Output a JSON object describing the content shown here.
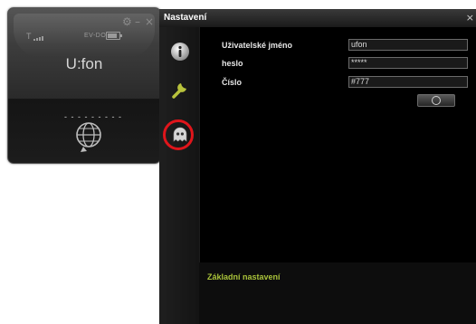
{
  "widget": {
    "name": "U:fon",
    "network": "EV-DO",
    "signal_label": "T",
    "battery_level": 0.8,
    "number_display": "- - - - - - - - -",
    "controls": {
      "settings_glyph": "⚙",
      "minimize_glyph": "–",
      "close_glyph": "×"
    },
    "icons": {
      "signal": "signal-icon",
      "battery": "battery-icon",
      "dial": "globe-call-icon"
    }
  },
  "settings_window": {
    "title": "Nastavení",
    "close_glyph": "×",
    "sidebar": [
      {
        "name": "info-icon",
        "glyph": "i"
      },
      {
        "name": "wrench-icon",
        "glyph": ""
      },
      {
        "name": "ghost-icon",
        "glyph": ""
      }
    ],
    "highlight_color": "#e0151b",
    "form": {
      "username_label": "Uživatelské jméno",
      "username_value": "ufon",
      "password_label": "heslo",
      "password_value": "*****",
      "number_label": "Číslo",
      "number_value": "#777"
    },
    "footer_link": "Základní nastavení",
    "accent_color": "#a9c23a"
  }
}
